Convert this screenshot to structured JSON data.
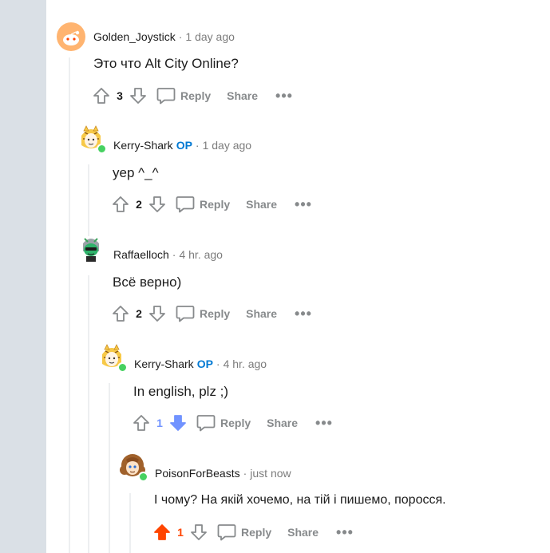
{
  "comments": [
    {
      "author": "Golden_Joystick",
      "op_badge": "",
      "time": "1 day ago",
      "body": "Это что Alt City Online?",
      "score": "3",
      "vote_state": "none",
      "reply_label": "Reply",
      "share_label": "Share"
    },
    {
      "author": "Kerry-Shark",
      "op_badge": "OP",
      "time": "1 day ago",
      "body": "yep ^_^",
      "score": "2",
      "vote_state": "none",
      "reply_label": "Reply",
      "share_label": "Share"
    },
    {
      "author": "Raffaelloch",
      "op_badge": "",
      "time": "4 hr. ago",
      "body": "Всё верно)",
      "score": "2",
      "vote_state": "none",
      "reply_label": "Reply",
      "share_label": "Share"
    },
    {
      "author": "Kerry-Shark",
      "op_badge": "OP",
      "time": "4 hr. ago",
      "body": "In english, plz ;)",
      "score": "1",
      "vote_state": "down",
      "reply_label": "Reply",
      "share_label": "Share"
    },
    {
      "author": "PoisonForBeasts",
      "op_badge": "",
      "time": "just now",
      "body": "І чому? На якій хочемо, на тій і пишемо, поросся.",
      "score": "1",
      "vote_state": "up",
      "reply_label": "Reply",
      "share_label": "Share"
    }
  ],
  "separator": "·",
  "more_glyph": "•••",
  "colors": {
    "upvote": "#ff4500",
    "downvote": "#7193ff",
    "op": "#0079d3",
    "online": "#46d160",
    "gutter": "#dae0e6"
  }
}
